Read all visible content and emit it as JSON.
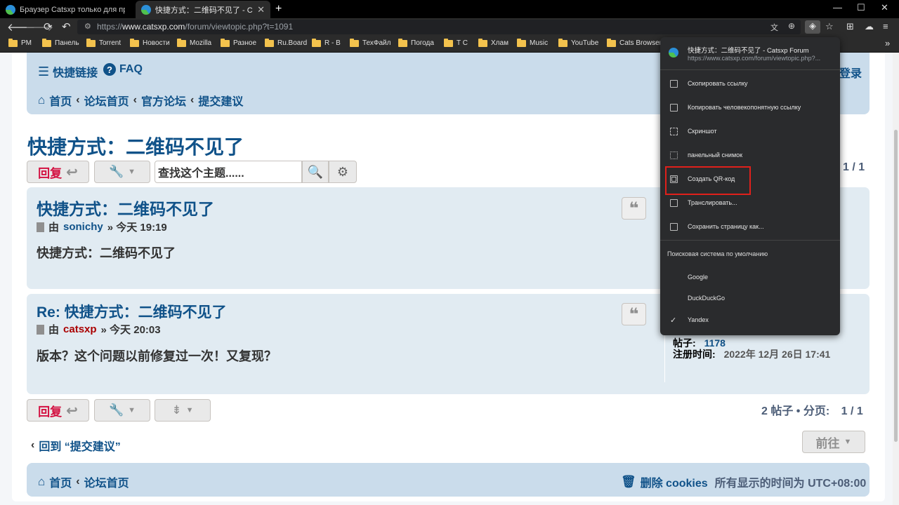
{
  "browser": {
    "tabs": [
      {
        "title": "Браузер Catsxp только для простоты и б"
      },
      {
        "title": "快捷方式：二维码不见了 - Catsxp Fo"
      }
    ],
    "url_prefix": "https://",
    "url_host": "www.catsxp.com",
    "url_path": "/forum/viewtopic.php?t=1091",
    "bookmarks": [
      "PM",
      "Панель",
      "Torrent",
      "Новости",
      "Mozilla",
      "Разное",
      "Ru.Board",
      "R - B",
      "ТехФайл",
      "Погода",
      "T C",
      "Хлам",
      "Music",
      "YouTube",
      "Cats Browser"
    ],
    "more": "»"
  },
  "menu": {
    "header_title": "快捷方式：二维码不见了 - Catsxp Forum",
    "header_url": "https://www.catsxp.com/forum/viewtopic.php?...",
    "items": [
      "Скопировать ссылку",
      "Копировать человекопонятную ссылку",
      "Скриншот",
      "панельный снимок",
      "Создать QR-код",
      "Транслировать...",
      "Сохранить страницу как..."
    ],
    "search_label": "Поисковая система по умолчанию",
    "engines": [
      "Google",
      "DuckDuckGo",
      "Yandex"
    ],
    "highlight_color": "#e0201b"
  },
  "forum": {
    "quicklinks": "快捷链接",
    "faq": "FAQ",
    "login": "登录",
    "crumbs": [
      "首页",
      "论坛首页",
      "官方论坛",
      "提交建议"
    ],
    "title": "快捷方式：二维码不见了",
    "reply": "回复",
    "search_placeholder": "查找这个主题......",
    "page_top": "1 / 1",
    "posts": [
      {
        "title": "快捷方式：二维码不见了",
        "by": "由",
        "author": "sonichy",
        "time": "» 今天 19:19",
        "body": "快捷方式：二维码不见了",
        "author_color": "#105289"
      },
      {
        "title": "Re: 快捷方式：二维码不见了",
        "by": "由",
        "author": "catsxp",
        "time": "» 今天 20:03",
        "body": "版本？这个问题以前修复过一次！又复现？",
        "author_color": "#aa0000"
      }
    ],
    "profile": {
      "posts_label": "帖子:",
      "posts_value": "1178",
      "reg_label": "注册时间:",
      "reg_value": "2022年 12月 26日 17:41"
    },
    "pagination_bottom": "2 帖子 • 分页:",
    "page_bottom": "1 / 1",
    "back": "回到 “提交建议”",
    "goto": "前往",
    "footer_home": "首页",
    "footer_index": "论坛首页",
    "delete_cookies": "删除 cookies",
    "timezone": "所有显示的时间为 UTC+08:00"
  }
}
